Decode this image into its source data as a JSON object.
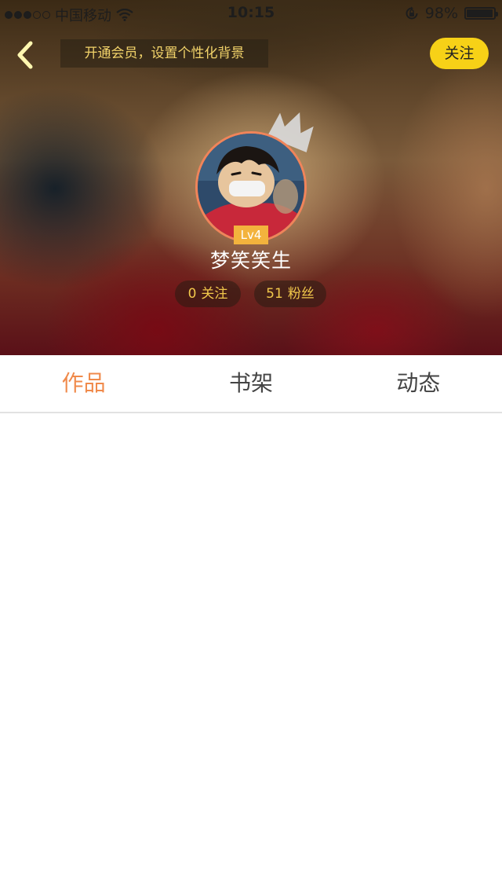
{
  "status_bar": {
    "carrier": "中国移动",
    "time": "10:15",
    "battery": "98%",
    "battery_level": 0.98,
    "signal_bars_filled": 3,
    "signal_bars_total": 5
  },
  "header": {
    "vip_banner": "开通会员，设置个性化背景",
    "follow_label": "关注"
  },
  "profile": {
    "level": "Lv4",
    "username": "梦笑笑生",
    "following_count": "0",
    "following_label": "关注",
    "fans_count": "51",
    "fans_label": "粉丝"
  },
  "tabs": [
    {
      "label": "作品",
      "active": true
    },
    {
      "label": "书架",
      "active": false
    },
    {
      "label": "动态",
      "active": false
    }
  ],
  "colors": {
    "accent": "#f08a4b",
    "follow_button": "#f7d117",
    "stat_text": "#f2c84b",
    "level_badge": "#f3b33d"
  },
  "icons": {
    "back": "chevron-left-icon",
    "crown": "crown-icon",
    "wifi": "wifi-icon",
    "rotation_lock": "rotation-lock-icon",
    "battery": "battery-icon"
  }
}
